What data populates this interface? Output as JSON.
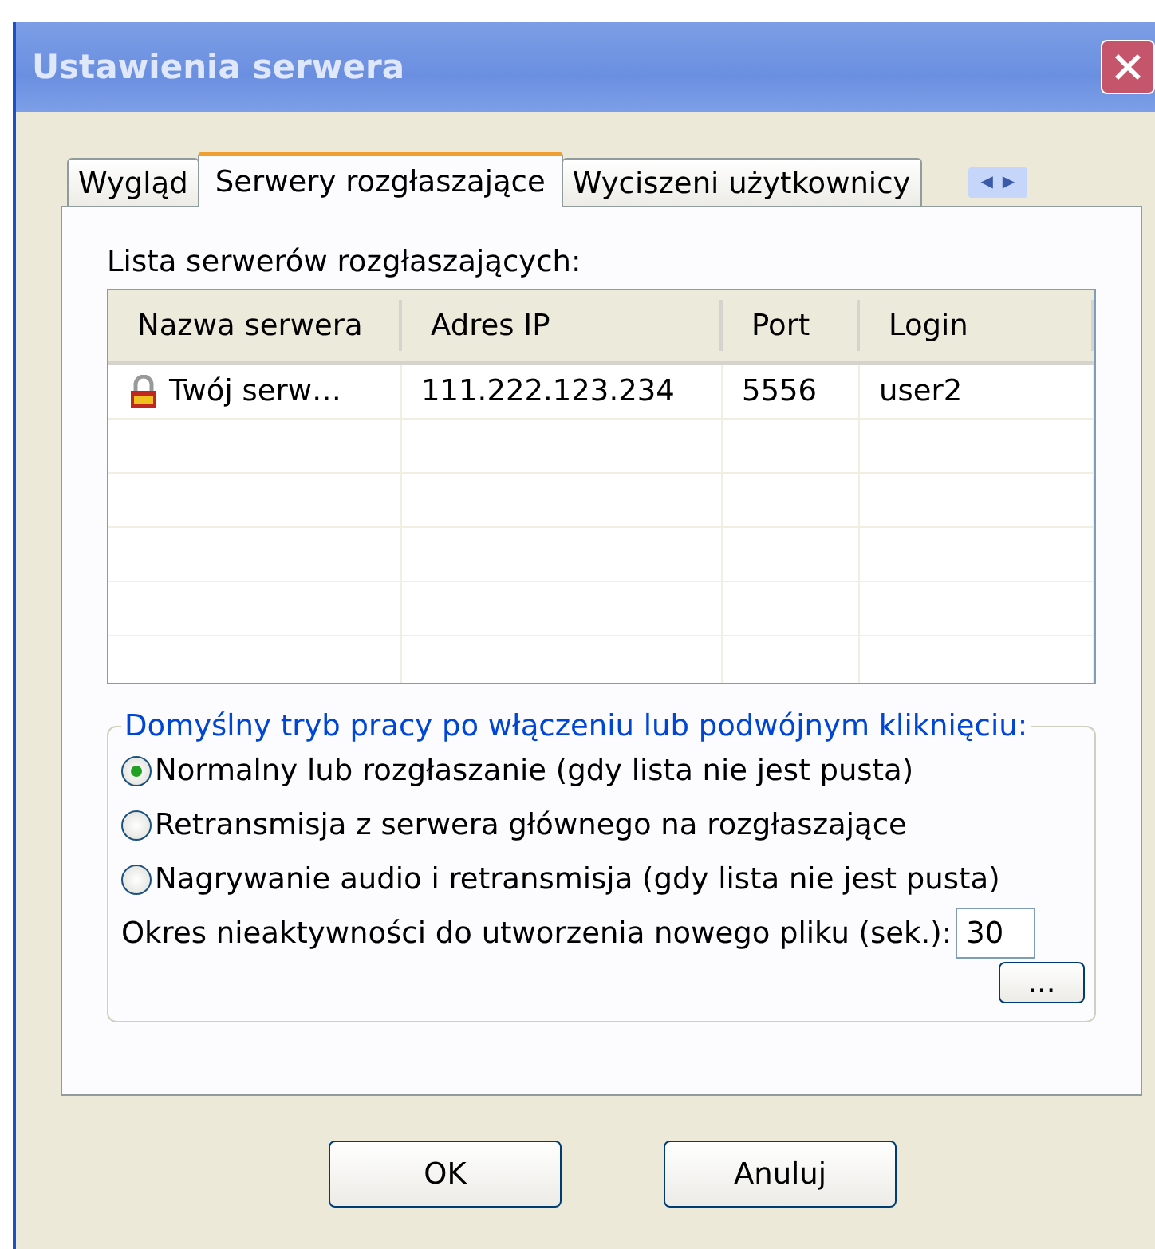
{
  "window": {
    "title": "Ustawienia serwera"
  },
  "tabs": [
    {
      "label": "Wygląd",
      "selected": false
    },
    {
      "label": "Serwery rozgłaszające",
      "selected": true
    },
    {
      "label": "Wyciszeni użytkownicy",
      "selected": false
    }
  ],
  "tab_scroll": {
    "left": "◀",
    "right": "▶"
  },
  "list_label": "Lista serwerów rozgłaszających:",
  "table": {
    "columns": [
      "Nazwa serwera",
      "Adres IP",
      "Port",
      "Login"
    ],
    "rows": [
      {
        "ssl": true,
        "cells": [
          "Twój serw…",
          "111.222.123.234",
          "5556",
          "user2"
        ]
      }
    ]
  },
  "mode_group": {
    "title": "Domyślny tryb pracy po włączeniu lub podwójnym kliknięciu:",
    "options": [
      {
        "label": "Normalny lub rozgłaszanie (gdy lista nie jest pusta)",
        "selected": true
      },
      {
        "label": "Retransmisja z serwera głównego na rozgłaszające",
        "selected": false
      },
      {
        "label": "Nagrywanie audio i retransmisja (gdy lista nie jest pusta)",
        "selected": false
      }
    ],
    "timeout_label": "Okres nieaktywności do utworzenia nowego pliku (sek.):",
    "timeout_value": "30",
    "more_button": "..."
  },
  "buttons": [
    "OK",
    "Anuluj"
  ]
}
